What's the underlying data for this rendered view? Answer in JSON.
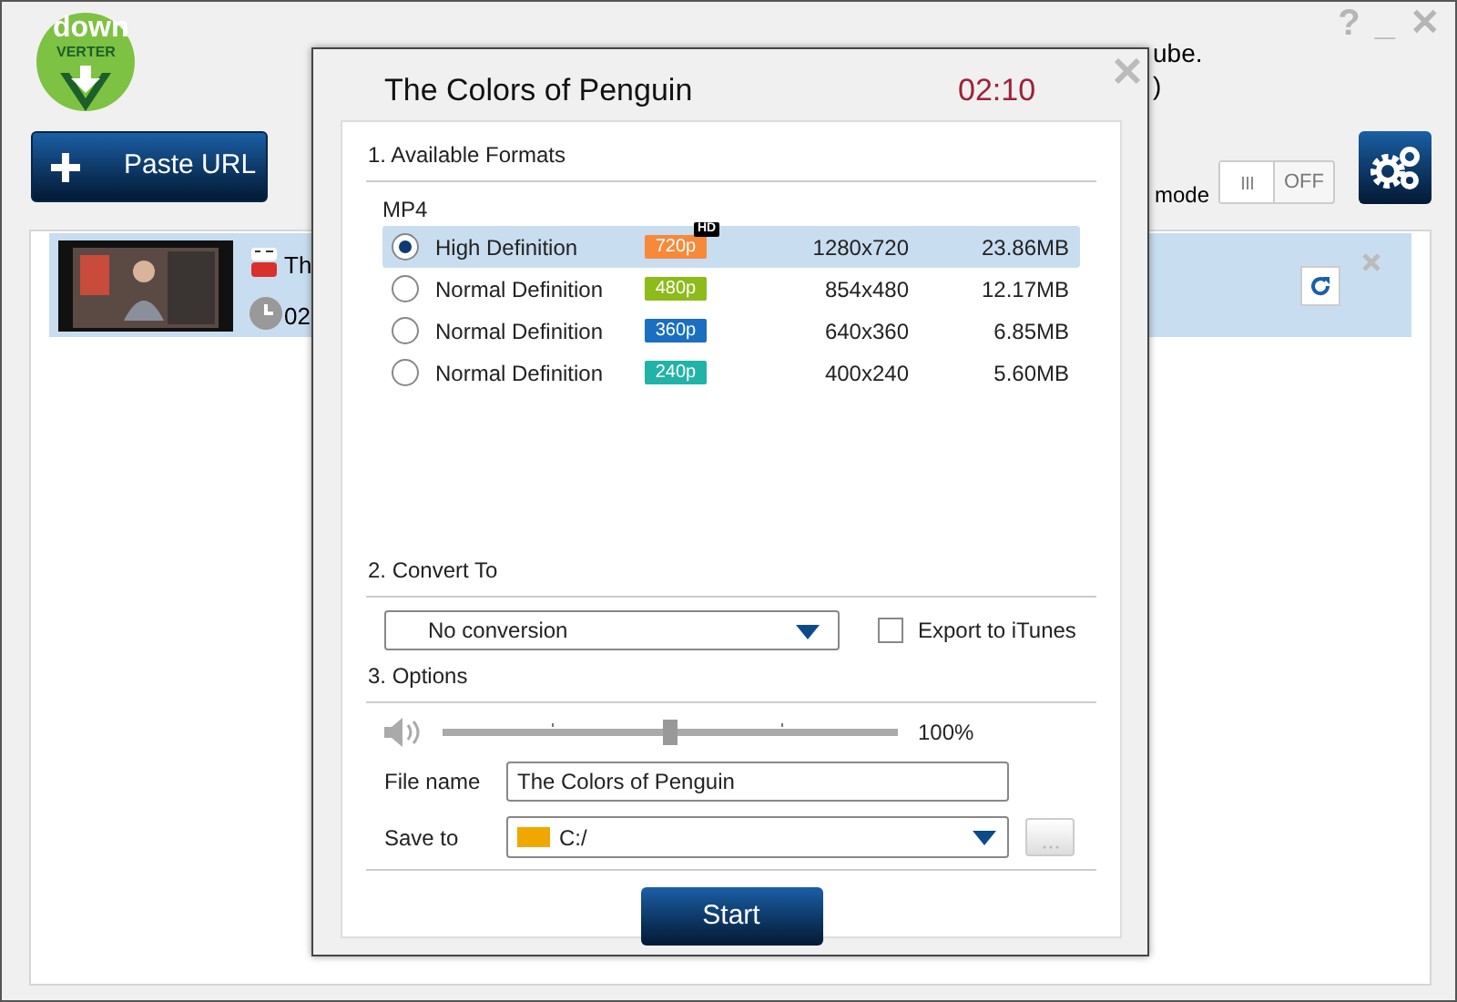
{
  "window": {
    "controls": [
      "?",
      "_",
      "✕"
    ]
  },
  "logo": {
    "top": "down",
    "bottom": "VERTER"
  },
  "background_text": {
    "tagline_end": "ube.",
    "line2_end": ")"
  },
  "paste_button": {
    "label": "Paste URL"
  },
  "mode_toggle": {
    "label": "mode",
    "state_text": "OFF",
    "on": false
  },
  "downloads": [
    {
      "title_start": "Th",
      "time_start": "02",
      "selected": true
    }
  ],
  "dialog": {
    "title": "The Colors of Penguin",
    "duration": "02:10",
    "formats_heading": "1. Available Formats",
    "container": "MP4",
    "formats": [
      {
        "name": "High Definition",
        "badge": "720p",
        "color": "#f7893a",
        "hd_tag": "HD",
        "resolution": "1280x720",
        "size": "23.86MB",
        "selected": true
      },
      {
        "name": "Normal Definition",
        "badge": "480p",
        "color": "#8cbb1a",
        "resolution": "854x480",
        "size": "12.17MB",
        "selected": false
      },
      {
        "name": "Normal Definition",
        "badge": "360p",
        "color": "#1a6fc0",
        "resolution": "640x360",
        "size": "6.85MB",
        "selected": false
      },
      {
        "name": "Normal Definition",
        "badge": "240p",
        "color": "#22b3a8",
        "resolution": "400x240",
        "size": "5.60MB",
        "selected": false
      }
    ],
    "convert_heading": "2. Convert To",
    "conversion": "No conversion",
    "itunes": {
      "label": "Export to iTunes",
      "checked": false
    },
    "options_heading": "3. Options",
    "volume": {
      "level": 0.5,
      "reading": "100%"
    },
    "file_name": {
      "label": "File name",
      "value": "The Colors of Penguin"
    },
    "save_to": {
      "label": "Save to",
      "value": "C:/"
    },
    "start_button": "Start"
  }
}
